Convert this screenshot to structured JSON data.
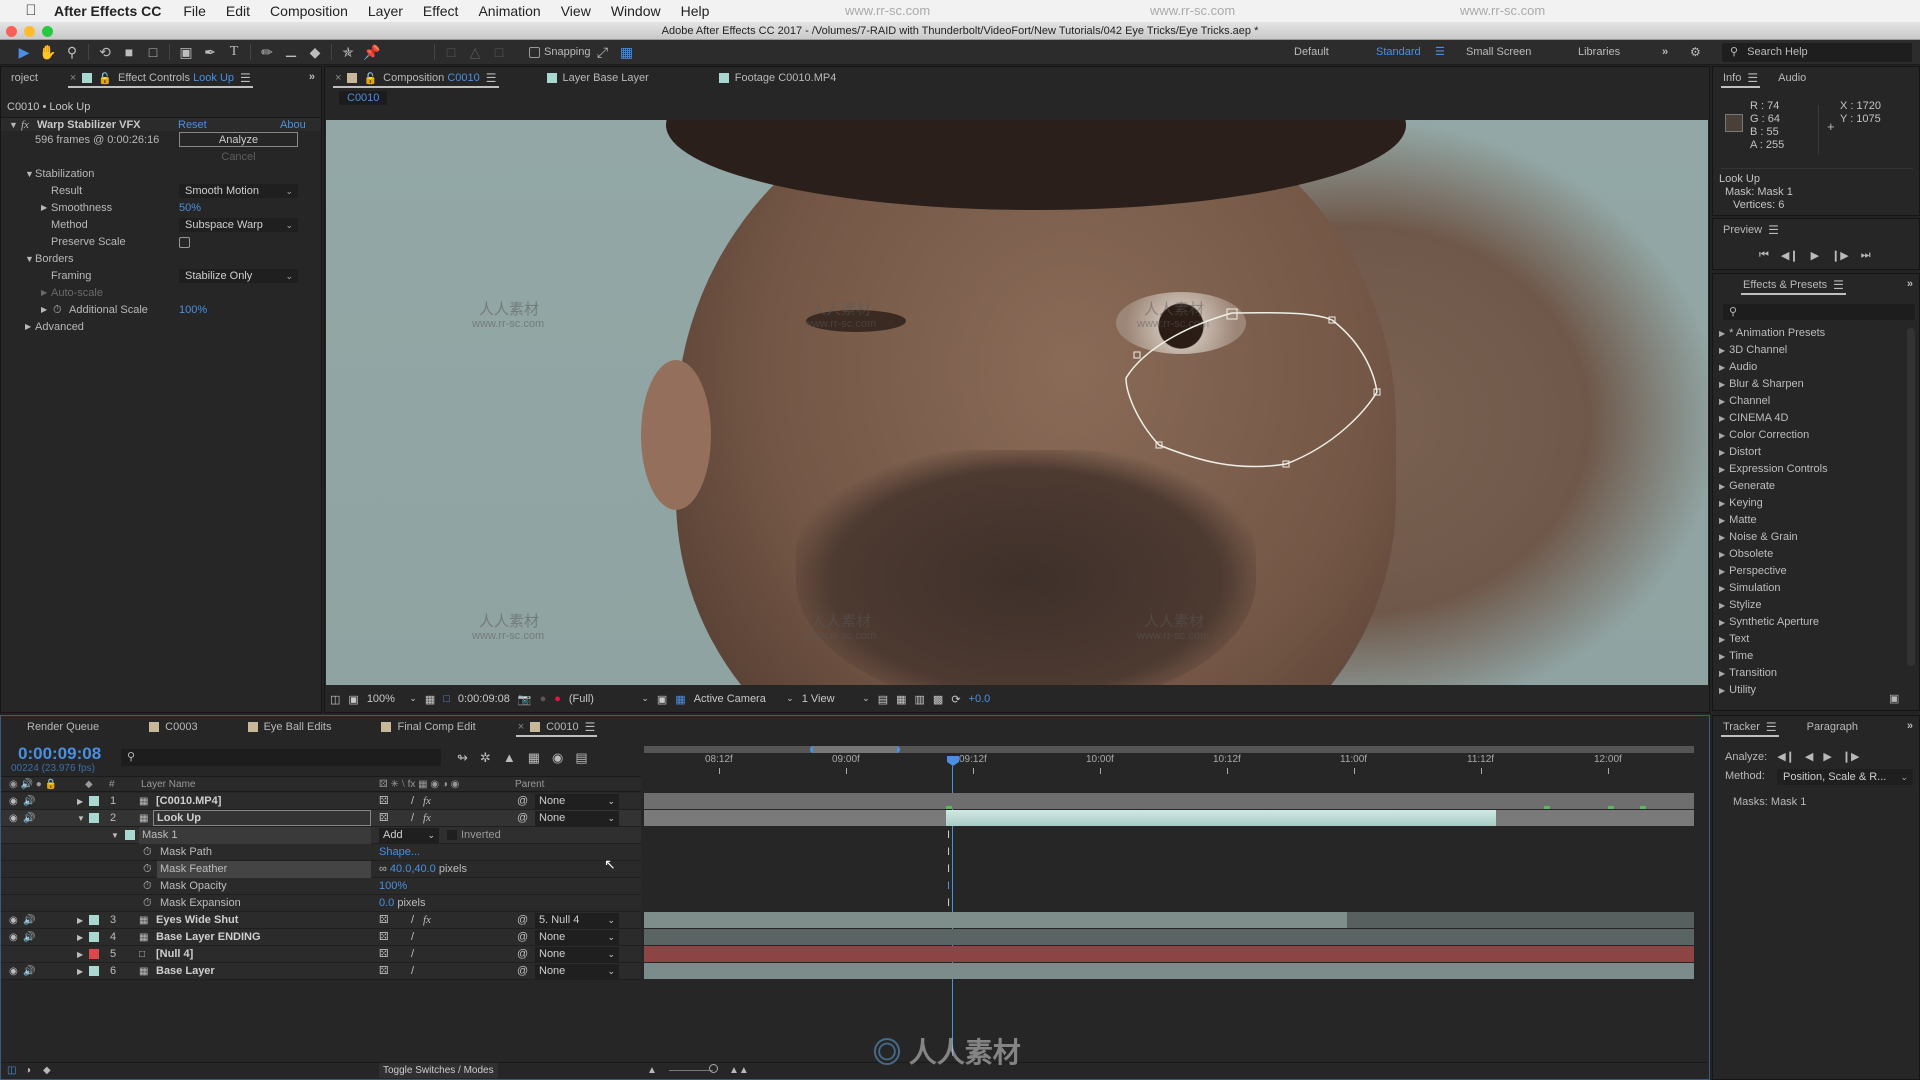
{
  "menubar": {
    "app_name": "After Effects CC",
    "items": [
      "File",
      "Edit",
      "Composition",
      "Layer",
      "Effect",
      "Animation",
      "View",
      "Window",
      "Help"
    ]
  },
  "titlebar": {
    "title": "Adobe After Effects CC 2017 - /Volumes/7-RAID with Thunderbolt/VideoFort/New Tutorials/042 Eye Tricks/Eye Tricks.aep *"
  },
  "toolbar": {
    "tools": [
      "selection-tool",
      "hand-tool",
      "zoom-tool",
      "rotation-tool",
      "camera-tool",
      "pan-behind-tool",
      "rectangle-tool",
      "pen-tool",
      "type-tool",
      "brush-tool",
      "clone-stamp-tool",
      "eraser-tool",
      "roto-brush-tool",
      "puppet-pin-tool"
    ],
    "snapping_label": "Snapping",
    "workspaces": [
      "Default",
      "Standard",
      "Small Screen",
      "Libraries"
    ],
    "active_workspace": "Standard",
    "search_placeholder": "Search Help"
  },
  "effect_controls": {
    "tabs": {
      "project": "roject",
      "effect_controls_prefix": "Effect Controls",
      "effect_controls_layer": "Look Up"
    },
    "breadcrumb": "C0010 • Look Up",
    "effect_name": "Warp Stabilizer VFX",
    "reset": "Reset",
    "about": "Abou",
    "frames_info": "596 frames @ 0:00:26:16",
    "analyze": "Analyze",
    "cancel": "Cancel",
    "stabilization": "Stabilization",
    "result_label": "Result",
    "result_value": "Smooth Motion",
    "smoothness_label": "Smoothness",
    "smoothness_value": "50%",
    "method_label": "Method",
    "method_value": "Subspace Warp",
    "preserve_scale_label": "Preserve Scale",
    "preserve_scale_checked": false,
    "borders": "Borders",
    "framing_label": "Framing",
    "framing_value": "Stabilize Only",
    "auto_scale_label": "Auto-scale",
    "additional_scale_label": "Additional Scale",
    "additional_scale_value": "100%",
    "advanced": "Advanced"
  },
  "composition": {
    "tabs": [
      {
        "prefix": "Composition",
        "name": "C0010",
        "active": true,
        "color": "#c9b79a"
      },
      {
        "prefix": "Layer",
        "name": "Base Layer",
        "active": false,
        "color": "#a8d8cf"
      },
      {
        "prefix": "Footage",
        "name": "C0010.MP4",
        "active": false,
        "color": "#a8d8cf"
      }
    ],
    "breadcrumb": "C0010",
    "watermark_cn": "人人素材",
    "watermark_url": "www.rr-sc.com",
    "mask_vertices": 6
  },
  "viewer_footer": {
    "zoom": "100%",
    "timecode": "0:00:09:08",
    "resolution": "(Full)",
    "camera": "Active Camera",
    "views": "1 View",
    "exposure": "+0.0"
  },
  "info": {
    "tabs": [
      "Info",
      "Audio"
    ],
    "r": "R : 74",
    "g": "G : 64",
    "b": "B : 55",
    "a": "A : 255",
    "x": "X : 1720",
    "y": "Y : 1075",
    "swatch_color": "#4a4037",
    "layer": "Look Up",
    "mask": "Mask: Mask 1",
    "vertices": "Vertices: 6"
  },
  "preview": {
    "title": "Preview",
    "controls": [
      "first-frame",
      "prev-frame",
      "play",
      "next-frame",
      "last-frame"
    ]
  },
  "effects_presets": {
    "title": "Effects & Presets",
    "search_placeholder": "",
    "items": [
      "* Animation Presets",
      "3D Channel",
      "Audio",
      "Blur & Sharpen",
      "Channel",
      "CINEMA 4D",
      "Color Correction",
      "Distort",
      "Expression Controls",
      "Generate",
      "Keying",
      "Matte",
      "Noise & Grain",
      "Obsolete",
      "Perspective",
      "Simulation",
      "Stylize",
      "Synthetic Aperture",
      "Text",
      "Time",
      "Transition",
      "Utility"
    ]
  },
  "timeline": {
    "tabs": [
      {
        "name": "Render Queue",
        "color": null
      },
      {
        "name": "C0003",
        "color": "#c9b79a"
      },
      {
        "name": "Eye Ball Edits",
        "color": "#c9b79a"
      },
      {
        "name": "Final Comp Edit",
        "color": "#c9b79a"
      },
      {
        "name": "C0010",
        "color": "#c9b79a",
        "active": true
      }
    ],
    "current_time": "0:00:09:08",
    "frame_info": "00224 (23.976 fps)",
    "search_placeholder": "",
    "columns": {
      "num": "#",
      "layer_name": "Layer Name",
      "parent": "Parent"
    },
    "ruler": [
      "08:12f",
      "09:00f",
      "09:12f",
      "10:00f",
      "10:12f",
      "11:00f",
      "11:12f",
      "12:00f"
    ],
    "playhead_time": "09:08f",
    "layers": [
      {
        "num": "1",
        "name": "[C0010.MP4]",
        "color": "#a8d8cf",
        "expanded": false,
        "fx": true,
        "parent": "None",
        "visible": true
      },
      {
        "num": "2",
        "name": "Look Up",
        "color": "#a8d8cf",
        "expanded": true,
        "fx": true,
        "parent": "None",
        "visible": true,
        "selected": true
      },
      {
        "num": "3",
        "name": "Eyes Wide Shut",
        "color": "#a8d8cf",
        "expanded": false,
        "fx": true,
        "parent": "5. Null 4",
        "visible": true
      },
      {
        "num": "4",
        "name": "Base Layer  ENDING",
        "color": "#a8d8cf",
        "expanded": false,
        "fx": false,
        "parent": "None",
        "visible": true
      },
      {
        "num": "5",
        "name": "[Null 4]",
        "color": "#d9484a",
        "expanded": false,
        "fx": false,
        "parent": "None",
        "visible": false
      },
      {
        "num": "6",
        "name": "Base Layer",
        "color": "#a8d8cf",
        "expanded": false,
        "fx": false,
        "parent": "None",
        "visible": true
      }
    ],
    "mask": {
      "name": "Mask 1",
      "mode": "Add",
      "inverted_label": "Inverted",
      "path_label": "Mask Path",
      "path_value": "Shape...",
      "feather_label": "Mask Feather",
      "feather_value": "40.0,40.0",
      "feather_unit": "pixels",
      "opacity_label": "Mask Opacity",
      "opacity_value": "100%",
      "expansion_label": "Mask Expansion",
      "expansion_value": "0.0",
      "expansion_unit": "pixels"
    },
    "toggle_label": "Toggle Switches / Modes"
  },
  "tracker": {
    "tabs": [
      "Tracker",
      "Paragraph"
    ],
    "analyze_label": "Analyze:",
    "method_label": "Method:",
    "method_value": "Position, Scale & R...",
    "masks_label": "Masks:",
    "masks_value": "Mask 1"
  },
  "watermark": {
    "cn": "人人素材",
    "url": "www.rr-sc.com"
  }
}
